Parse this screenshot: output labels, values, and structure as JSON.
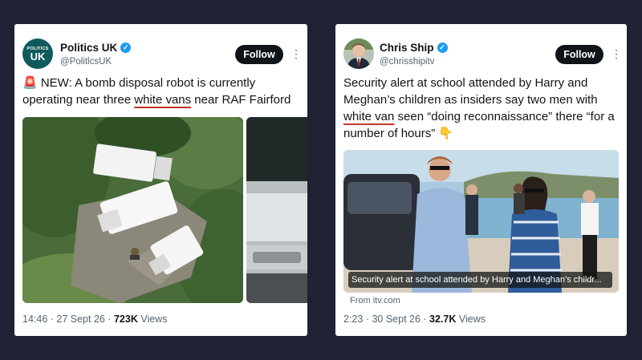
{
  "tweets": [
    {
      "display_name": "Politics UK",
      "handle": "@PolitlcsUK",
      "avatar_text_small": "POLITICS",
      "avatar_text_big": "UK",
      "follow_label": "Follow",
      "text_parts": [
        "🚨 NEW: A bomb disposal robot is currently operating near three ",
        "white vans",
        " near RAF Fairford"
      ],
      "time": "14:46",
      "date": "27 Sept 26",
      "views_count": "723K",
      "views_label": "Views"
    },
    {
      "display_name": "Chris Ship",
      "handle": "@chrisshipitv",
      "follow_label": "Follow",
      "text_parts": [
        "Security alert at school attended by Harry and Meghan’s children as insiders say two men with ",
        "white van",
        " seen “doing reconnaissance” there “for a number of hours” 👇"
      ],
      "media_caption": "Security alert at school attended by Harry and Meghan’s childr...",
      "link_source": "From itv.com",
      "time": "2:23",
      "date": "30 Sept 26",
      "views_count": "32.7K",
      "views_label": "Views"
    }
  ],
  "icons": {
    "verified": "verified-badge-icon",
    "more": "more-options-icon"
  },
  "colors": {
    "background": "#1f2233",
    "verified_blue": "#1d9bf0",
    "underline_red": "#c0392b",
    "follow_button": "#0f1419"
  }
}
